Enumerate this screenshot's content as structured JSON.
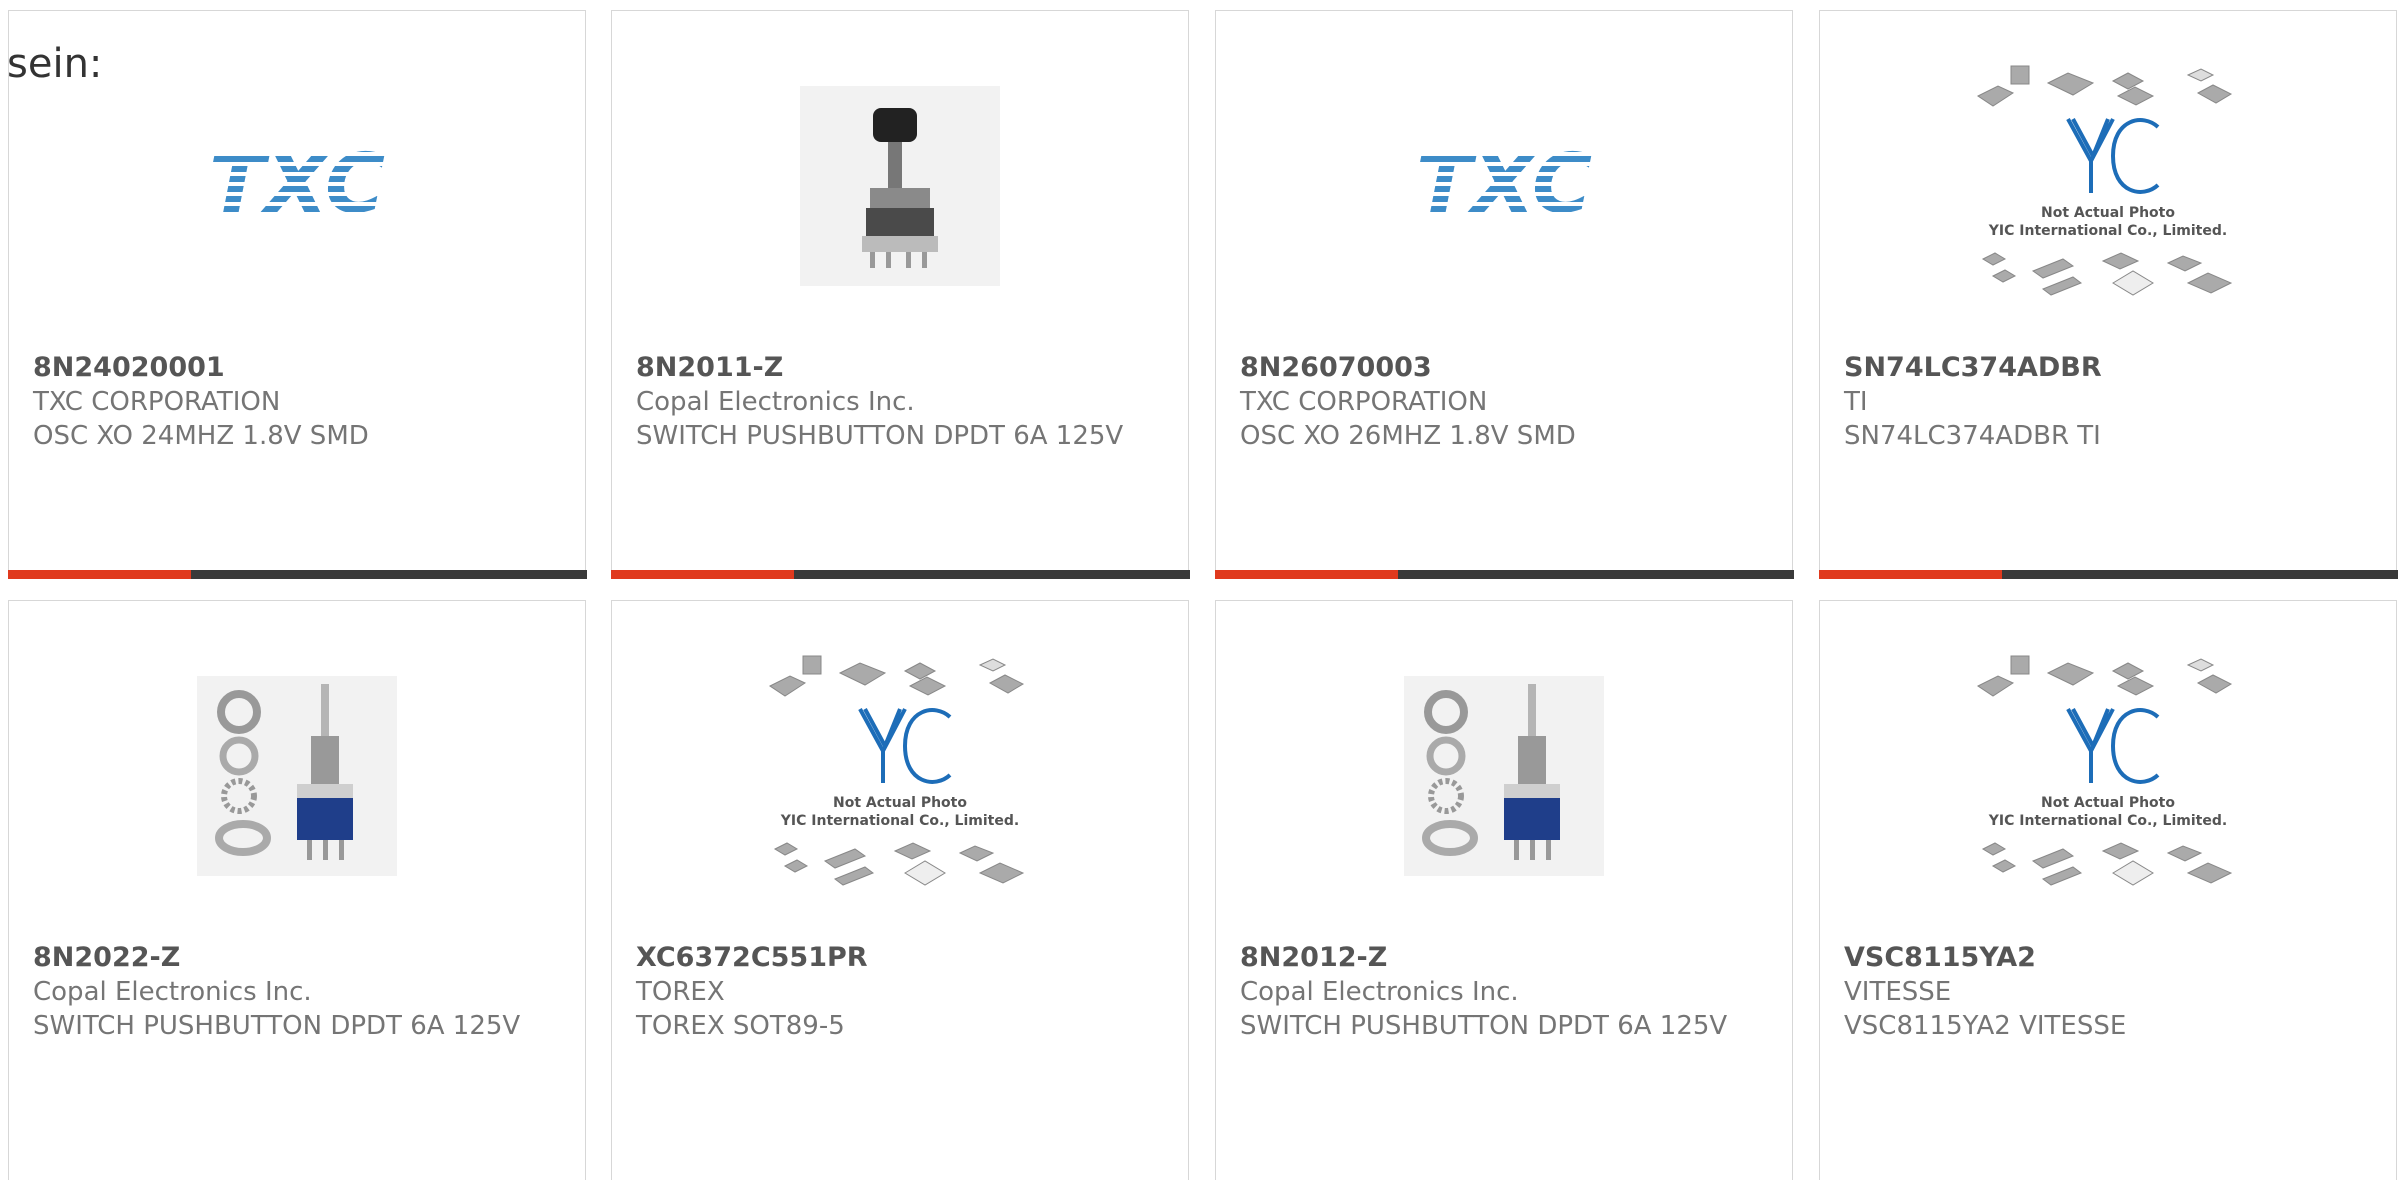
{
  "header_text": "sein:",
  "accent_color": "#e03a1e",
  "bar_color": "#3a3a3a",
  "products": [
    {
      "part_number": "8N24020001",
      "manufacturer": "TXC CORPORATION",
      "description": "OSC XO 24MHZ 1.8V SMD",
      "image": "txc-logo",
      "logo_text": "TXC"
    },
    {
      "part_number": "8N2011-Z",
      "manufacturer": "Copal Electronics Inc.",
      "description": "SWITCH PUSHBUTTON DPDT 6A 125V",
      "image": "pushbutton-switch-photo"
    },
    {
      "part_number": "8N26070003",
      "manufacturer": "TXC CORPORATION",
      "description": "OSC XO 26MHZ 1.8V SMD",
      "image": "txc-logo",
      "logo_text": "TXC"
    },
    {
      "part_number": "SN74LC374ADBR",
      "manufacturer": "TI",
      "description": "SN74LC374ADBR TI",
      "image": "yic-placeholder",
      "placeholder_line1": "Not Actual Photo",
      "placeholder_line2": "YIC International Co., Limited."
    },
    {
      "part_number": "8N2022-Z",
      "manufacturer": "Copal Electronics Inc.",
      "description": "SWITCH PUSHBUTTON DPDT 6A 125V",
      "image": "toggle-switch-photo"
    },
    {
      "part_number": "XC6372C551PR",
      "manufacturer": "TOREX",
      "description": "TOREX SOT89-5",
      "image": "yic-placeholder",
      "placeholder_line1": "Not Actual Photo",
      "placeholder_line2": "YIC International Co., Limited."
    },
    {
      "part_number": "8N2012-Z",
      "manufacturer": "Copal Electronics Inc.",
      "description": "SWITCH PUSHBUTTON DPDT 6A 125V",
      "image": "toggle-switch-photo"
    },
    {
      "part_number": "VSC8115YA2",
      "manufacturer": "VITESSE",
      "description": "VSC8115YA2 VITESSE",
      "image": "yic-placeholder",
      "placeholder_line1": "Not Actual Photo",
      "placeholder_line2": "YIC International Co., Limited."
    }
  ]
}
